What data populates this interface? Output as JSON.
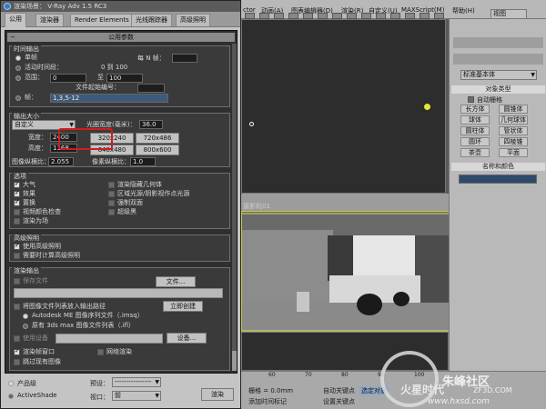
{
  "dialog": {
    "title": "渲染场景： V-Ray Adv 1.5 RC3",
    "tabs": [
      "公用",
      "渲染器",
      "Render Elements",
      "光线跟踪器",
      "高级照明"
    ],
    "rollout_title": "公用参数",
    "time_output": {
      "title": "时间输出",
      "single": "单帧",
      "every_n": "每 N 帧：",
      "active_segment": "活动时间段：",
      "active_range": "0 到 100",
      "range": "范围：",
      "range_from": "0",
      "range_to_label": "至",
      "range_to": "100",
      "file_start": "文件起始编号：",
      "frames": "帧：",
      "frames_value": "1,3,5-12"
    },
    "output_size": {
      "title": "输出大小",
      "preset": "自定义",
      "aperture_label": "光圈宽度(毫米)：",
      "aperture": "36.0",
      "width_label": "宽度：",
      "width": "2400",
      "height_label": "高度：",
      "height": "1168",
      "presets": [
        "320x240",
        "720x486",
        "640x480",
        "800x600"
      ],
      "image_aspect_label": "图像纵横比：",
      "image_aspect": "2.055",
      "pixel_aspect_label": "像素纵横比：",
      "pixel_aspect": "1.0"
    },
    "options": {
      "title": "选项",
      "atmosphere": "大气",
      "render_hidden": "渲染隐藏几何体",
      "effects": "效果",
      "area_lights": "区域光源/阴影视作点光源",
      "displacement": "置换",
      "force_2sided": "强制双面",
      "video_check": "视频颜色检查",
      "super_black": "超级黑",
      "render_to_fields": "渲染为场"
    },
    "adv_lighting": {
      "title": "高级照明",
      "use": "使用高级照明",
      "compute": "需要时计算高级照明"
    },
    "render_output": {
      "title": "渲染输出",
      "save_file": "保存文件",
      "files_btn": "文件...",
      "put_sequence": "将图像文件列表放入输出路径",
      "create_now": "立即创建",
      "autodesk_me": "Autodesk ME 图像序列文件（.imsq）",
      "legacy": "原有 3ds max 图像文件列表（.ifl）",
      "use_device": "使用设备",
      "devices_btn": "设备...",
      "frame_window": "渲染帧窗口",
      "net_render": "网络渲染",
      "skip_existing": "跳过现有图像"
    },
    "bottom": {
      "product": "产品级",
      "preset_label": "预设：",
      "preset_value": "----------------",
      "activeshade": "ActiveShade",
      "viewport_label": "视口：",
      "viewport_value": "前",
      "render_btn": "渲染"
    }
  },
  "app": {
    "menus": [
      "ctor",
      "动画(A)",
      "图表编辑器(D)",
      "渲染(R)",
      "自定义(U)",
      "MAXScript(M)",
      "帮助(H)"
    ],
    "view_label": "视图",
    "camera_viewport_label": "摄影机01"
  },
  "command_panel": {
    "dropdown": "标准基本体",
    "object_type_title": "对象类型",
    "auto_grid": "自动栅格",
    "objects": [
      "长方体",
      "圆锥体",
      "球体",
      "几何球体",
      "圆柱体",
      "管状体",
      "圆环",
      "四棱锥",
      "茶壶",
      "平面"
    ],
    "name_color_title": "名称和颜色"
  },
  "timeline": {
    "ticks": [
      "60",
      "70",
      "80",
      "90",
      "100"
    ],
    "grid_label": "栅格 = 0.0mm",
    "add_time_tag": "添加时间标记",
    "auto_key": "自动关键点",
    "set_key": "设置关键点",
    "selected": "选定对象"
  },
  "watermark": {
    "site": "火星时代",
    "domain": "www.hxsd.com",
    "brand": "朱峰社区",
    "url": "ZF3D.COM"
  },
  "colors": {
    "highlight_box": "#d21c1c",
    "camera_border": "#c9c94b"
  }
}
